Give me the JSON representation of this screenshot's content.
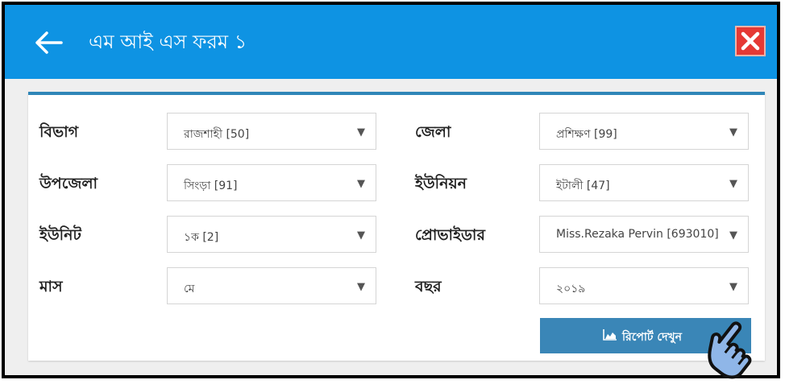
{
  "header": {
    "title": "এম আই এস ফরম ১",
    "bg_color": "#0e93e3",
    "back_icon": "arrow-left-icon",
    "close_icon": "close-icon"
  },
  "form": {
    "fields": [
      {
        "label": "বিভাগ",
        "value": "রাজশাহী [50]"
      },
      {
        "label": "জেলা",
        "value": "প্রশিক্ষণ [99]"
      },
      {
        "label": "উপজেলা",
        "value": "সিংড়া [91]"
      },
      {
        "label": "ইউনিয়ন",
        "value": "ইটালী [47]"
      },
      {
        "label": "ইউনিট",
        "value": "১ক [2]"
      },
      {
        "label": "প্রোভাইডার",
        "value": "Miss.Rezaka Pervin [693010]"
      },
      {
        "label": "মাস",
        "value": "মে"
      },
      {
        "label": "বছর",
        "value": "২০১৯"
      }
    ],
    "dropdown_arrow": "▼",
    "report_button": {
      "label": "রিপোর্ট দেখুন",
      "icon": "area-chart-icon",
      "color": "#3a86b7"
    }
  },
  "overlay": {
    "icon": "pointing-hand-icon"
  }
}
